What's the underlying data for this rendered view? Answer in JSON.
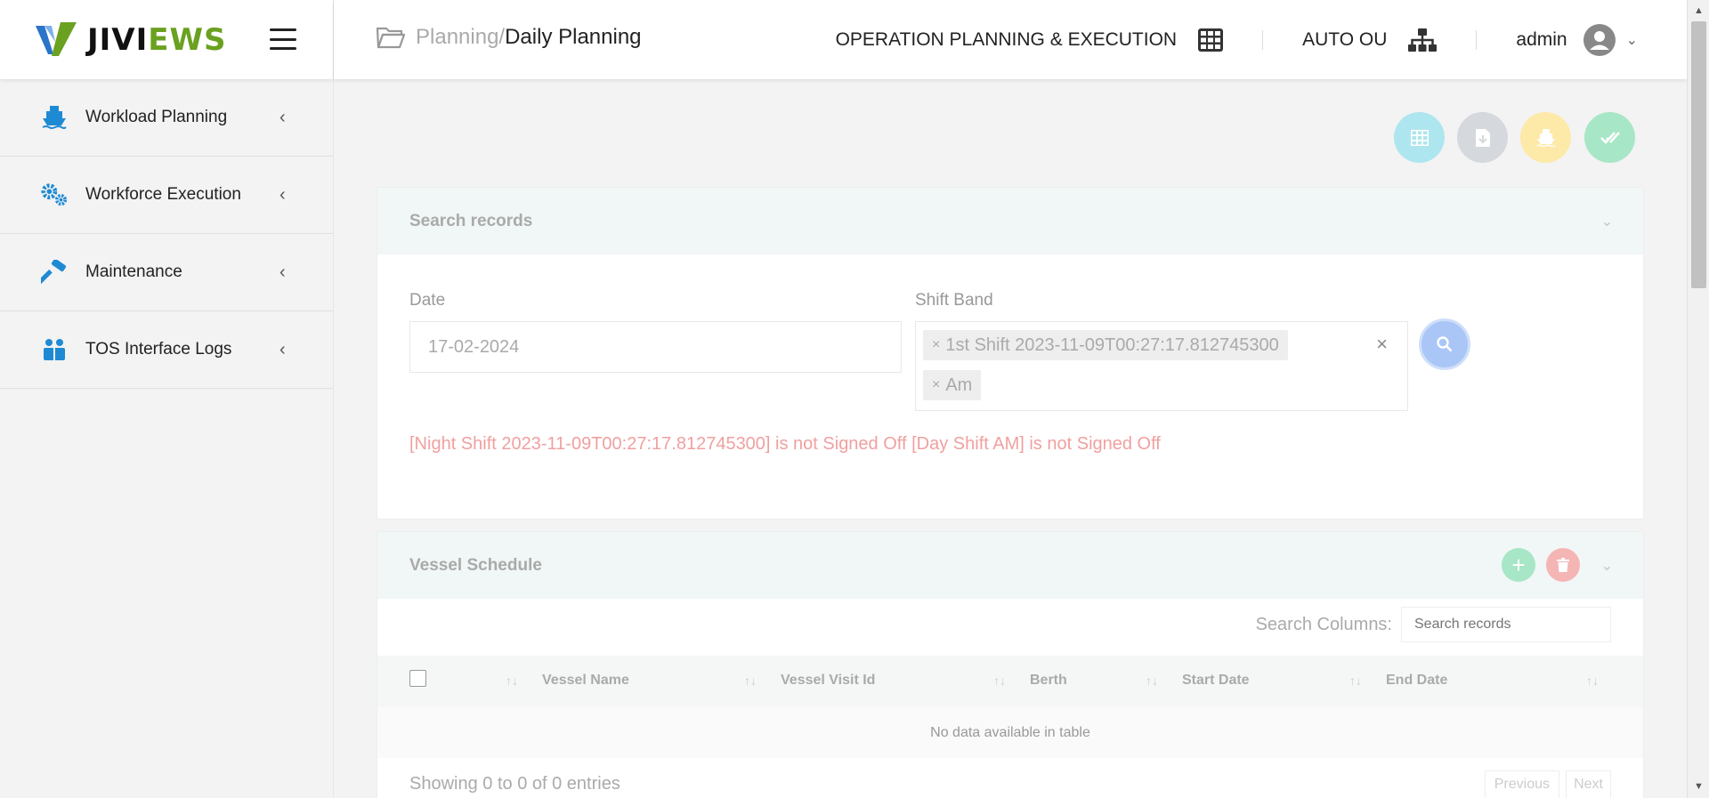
{
  "brand": {
    "name_part1": "JIVI",
    "name_part2": "EWS"
  },
  "sidebar": {
    "items": [
      {
        "label": "Workload Planning",
        "icon": "ship-icon"
      },
      {
        "label": "Workforce Execution",
        "icon": "gears-icon"
      },
      {
        "label": "Maintenance",
        "icon": "hammer-icon"
      },
      {
        "label": "TOS Interface Logs",
        "icon": "users-box-icon"
      }
    ]
  },
  "header": {
    "breadcrumb_parent": "Planning",
    "breadcrumb_sep": "/",
    "breadcrumb_current": "Daily Planning",
    "module": "OPERATION PLANNING & EXECUTION",
    "org_unit": "AUTO OU",
    "user": "admin"
  },
  "search": {
    "title": "Search records",
    "date_label": "Date",
    "date_value": "17-02-2024",
    "shift_label": "Shift Band",
    "shift_tags": [
      "1st Shift 2023-11-09T00:27:17.812745300",
      "Am"
    ],
    "clear_symbol": "×",
    "tag_remove_symbol": "×",
    "error": "[Night Shift 2023-11-09T00:27:17.812745300] is not Signed Off [Day Shift AM] is not Signed Off"
  },
  "vessel": {
    "title": "Vessel Schedule",
    "search_columns_label": "Search Columns:",
    "search_placeholder": "Search records",
    "columns": [
      "Vessel Name",
      "Vessel Visit Id",
      "Berth",
      "Start Date",
      "End Date"
    ],
    "empty_text": "No data available in table",
    "showing": "Showing 0 to 0 of 0 entries",
    "prev": "Previous",
    "next": "Next"
  },
  "colors": {
    "brand_green": "#6aa121",
    "icon_blue": "#1f8ad4",
    "btn_cyan": "#aee6ef",
    "btn_gray": "#d5d8dc",
    "btn_yellow": "#fde9a8",
    "btn_green": "#a7e6c6",
    "search_btn": "#a9c6f7",
    "error": "#f0a0a0"
  }
}
